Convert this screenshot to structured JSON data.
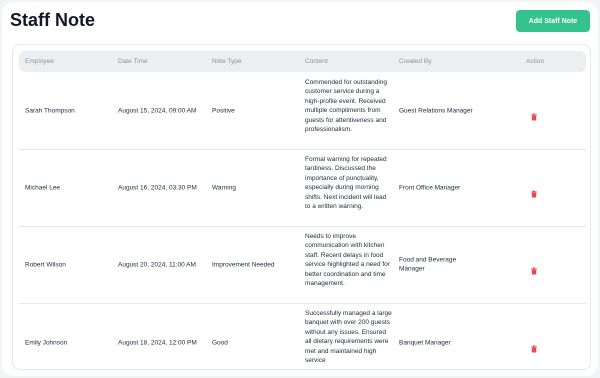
{
  "header": {
    "title": "Staff Note",
    "add_button": "Add Staff Note"
  },
  "table": {
    "columns": {
      "employee": "Employee",
      "date_time": "Date Time",
      "note_type": "Note Type",
      "content": "Content",
      "created_by": "Created By",
      "action": "Action"
    },
    "rows": [
      {
        "employee": "Sarah Thompson",
        "date_time": "August 15, 2024, 09:00 AM",
        "note_type": "Positive",
        "content": "Commended for outstanding customer service during a high-profile event. Received multiple compliments from guests for attentiveness and professionalism.",
        "created_by": "Guest Relations Manager",
        "action_icon": "trash-icon"
      },
      {
        "employee": "Michael Lee",
        "date_time": "August 16, 2024, 03:30 PM",
        "note_type": "Warning",
        "content": "Formal warning for repeated tardiness. Discussed the importance of punctuality, especially during morning shifts. Next incident will lead to a written warning.",
        "created_by": "Front Office Manager",
        "action_icon": "trash-icon"
      },
      {
        "employee": "Robert Wilson",
        "date_time": "August 20, 2024, 11:00 AM",
        "note_type": "Improvement Needed",
        "content": "Needs to improve communication with kitchen staff. Recent delays in food service highlighted a need for better coordination and time management.",
        "created_by": "Food and Beverage Manager",
        "action_icon": "trash-icon"
      },
      {
        "employee": "Emily Johnson",
        "date_time": "August 18, 2024, 12:00 PM",
        "note_type": "Good",
        "content": "Successfully managed a large banquet with over 200 guests without any issues. Ensured all dietary requirements were met and maintained high service",
        "created_by": "Banquet Manager",
        "action_icon": "trash-icon"
      }
    ]
  },
  "colors": {
    "accent": "#34c38f",
    "delete": "#e5484d",
    "header_bg": "#eceef1"
  }
}
